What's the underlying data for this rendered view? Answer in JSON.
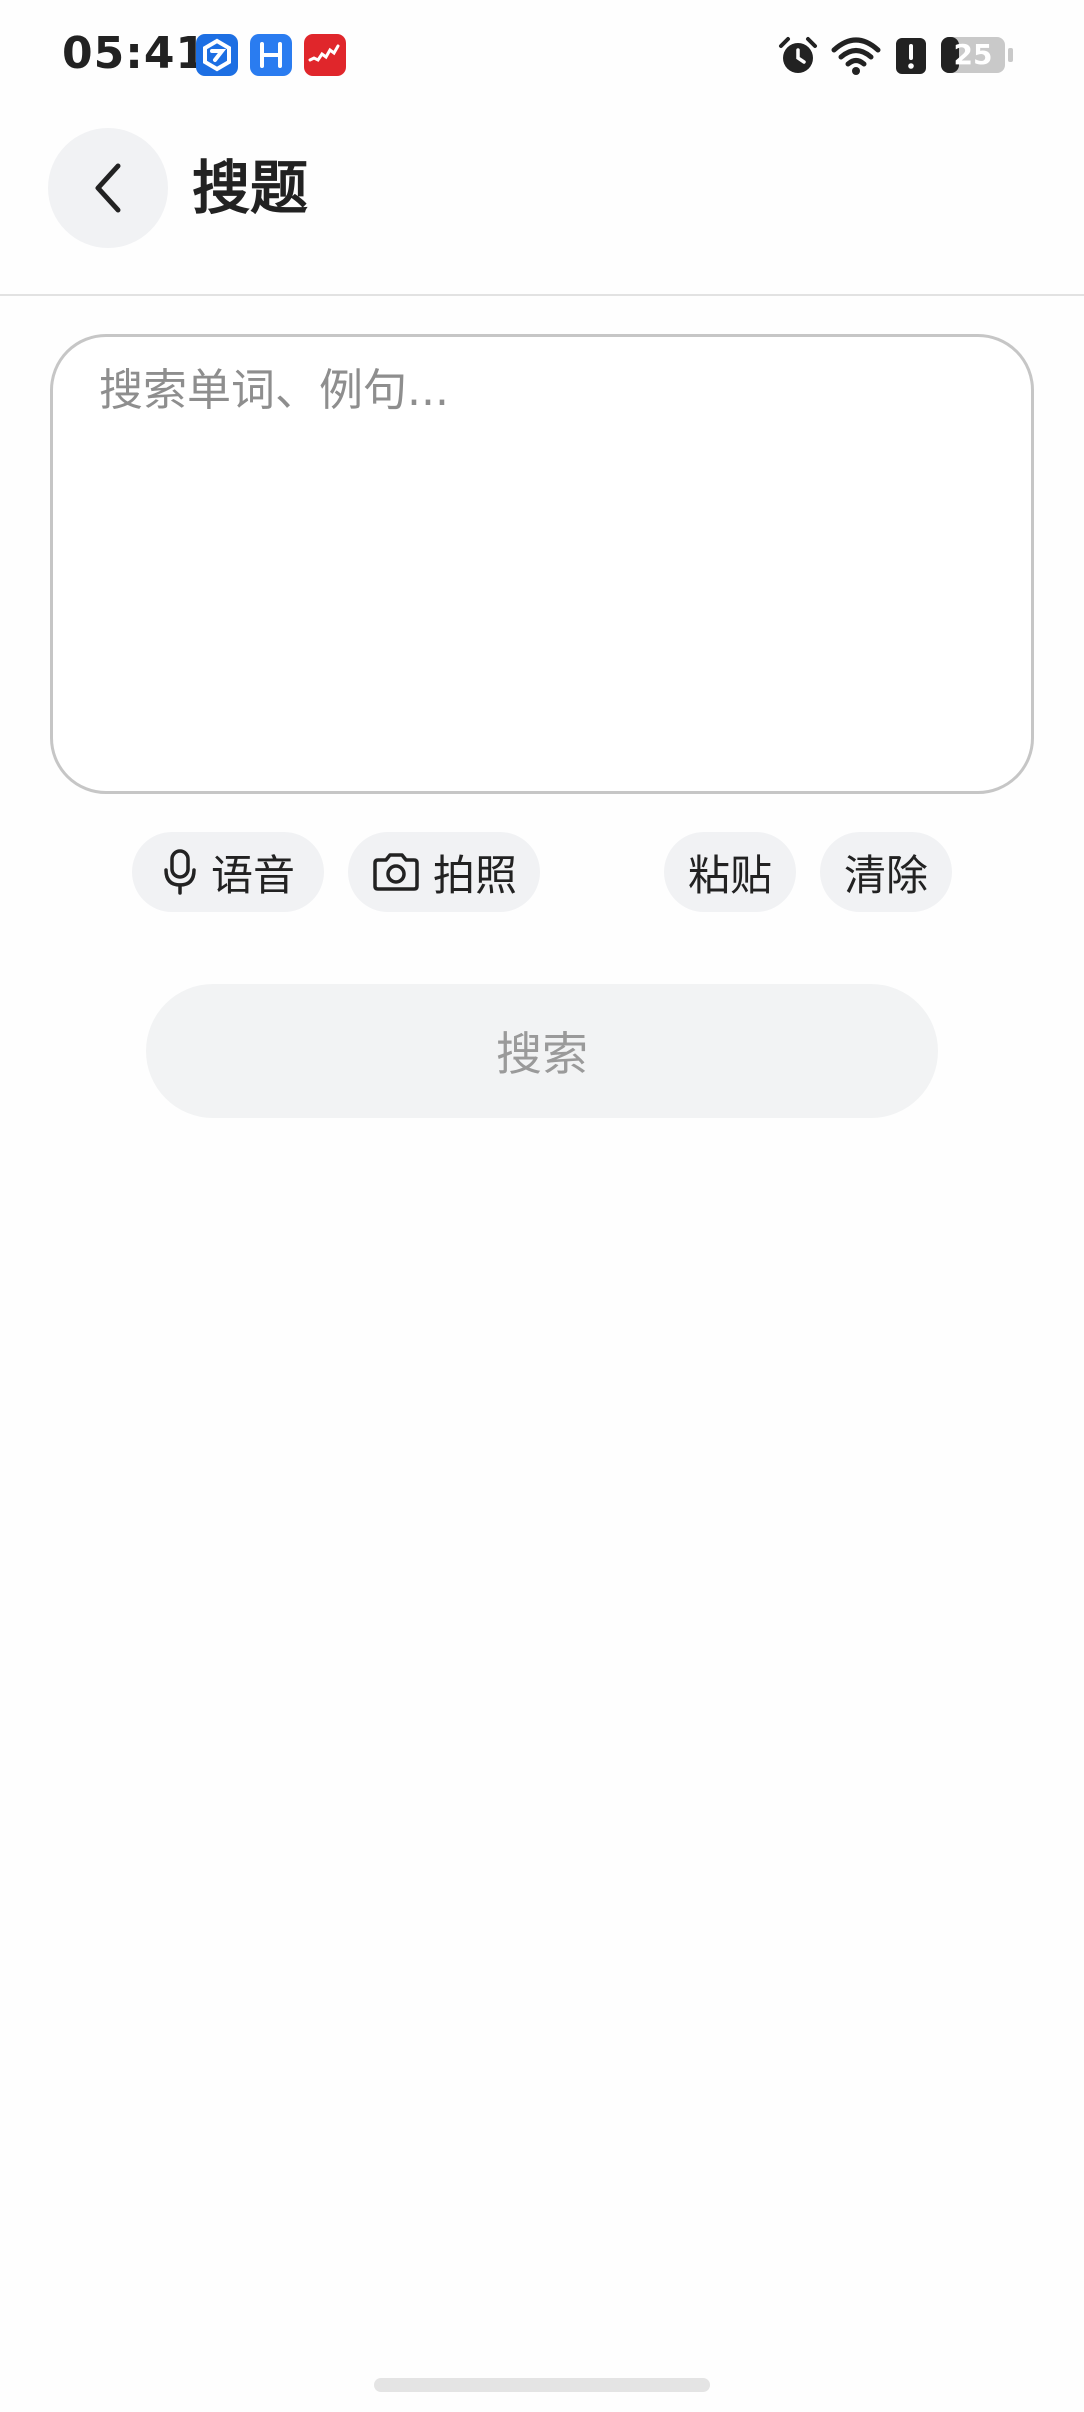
{
  "status_bar": {
    "time": "05:41",
    "battery_level": "25",
    "app_icons": [
      "tencent-map-icon",
      "hi-app-icon",
      "signal-app-icon"
    ],
    "right_icons": [
      "alarm-icon",
      "wifi-icon",
      "alert-icon",
      "battery-icon"
    ]
  },
  "header": {
    "back_icon": "chevron-left-icon",
    "title": "搜题"
  },
  "search": {
    "placeholder": "搜索单词、例句...",
    "value": ""
  },
  "actions": {
    "voice_label": "语音",
    "photo_label": "拍照",
    "paste_label": "粘贴",
    "clear_label": "清除"
  },
  "search_button": {
    "label": "搜索"
  },
  "colors": {
    "chip_background": "#f1f2f4",
    "textarea_border": "#c6c6c6",
    "placeholder_text": "#8e8e8e",
    "disabled_button_text": "#9a9a9a",
    "divider": "#e2e2e2"
  }
}
